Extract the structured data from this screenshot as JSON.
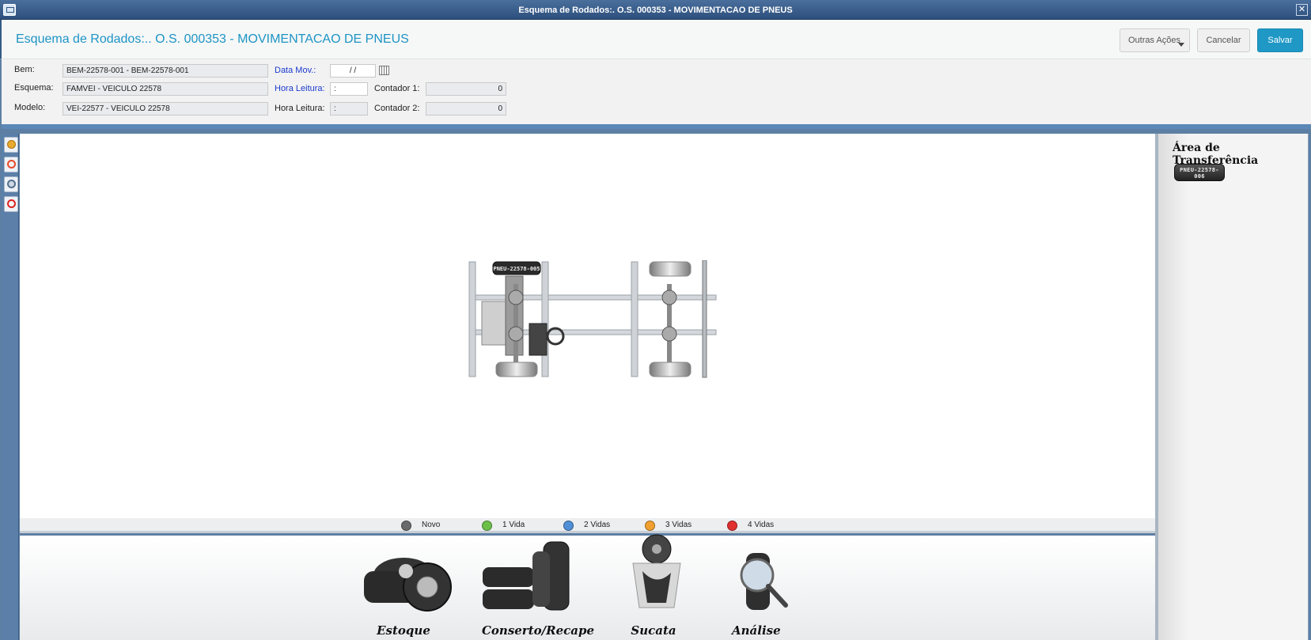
{
  "window": {
    "title": "Esquema de Rodados:. O.S. 000353 - MOVIMENTACAO DE PNEUS"
  },
  "header": {
    "title": "Esquema de Rodados:.. O.S. 000353 - MOVIMENTACAO DE PNEUS",
    "other_actions_label": "Outras Ações",
    "cancel_label": "Cancelar",
    "save_label": "Salvar"
  },
  "form": {
    "bem_label": "Bem:",
    "bem_value": "BEM-22578-001 - BEM-22578-001",
    "esquema_label": "Esquema:",
    "esquema_value": "FAMVEI - VEICULO 22578",
    "modelo_label": "Modelo:",
    "modelo_value": "VEI-22577 - VEICULO 22578",
    "data_mov_label": "Data Mov.:",
    "data_mov_value": "/ /",
    "hora_leitura1_label": "Hora Leitura:",
    "hora_leitura1_value": ":",
    "hora_leitura2_label": "Hora Leitura:",
    "hora_leitura2_value": ":",
    "contador1_label": "Contador 1:",
    "contador1_value": "0",
    "contador2_label": "Contador 2:",
    "contador2_value": "0"
  },
  "toolbar": {
    "icons": [
      "search-icon",
      "gauge-icon",
      "tire-swap-icon",
      "tire-remove-icon"
    ]
  },
  "diagram": {
    "tire_label": "PNEU-22578-005"
  },
  "legend": [
    {
      "label": "Novo",
      "color": "#6a6a6a"
    },
    {
      "label": "1 Vida",
      "color": "#6cc04a"
    },
    {
      "label": "2 Vidas",
      "color": "#4f8fd6"
    },
    {
      "label": "3 Vidas",
      "color": "#f0a030"
    },
    {
      "label": "4 Vidas",
      "color": "#e03030"
    }
  ],
  "categories": [
    {
      "label": "Estoque"
    },
    {
      "label": "Conserto/Recape"
    },
    {
      "label": "Sucata"
    },
    {
      "label": "Análise"
    }
  ],
  "transfer": {
    "title": "Área de Transferência",
    "tire_label": "PNEU-22578-006"
  },
  "colors": {
    "accent": "#1f98c6",
    "title_blue": "#1d95c5",
    "frame_blue": "#5c88b7"
  }
}
